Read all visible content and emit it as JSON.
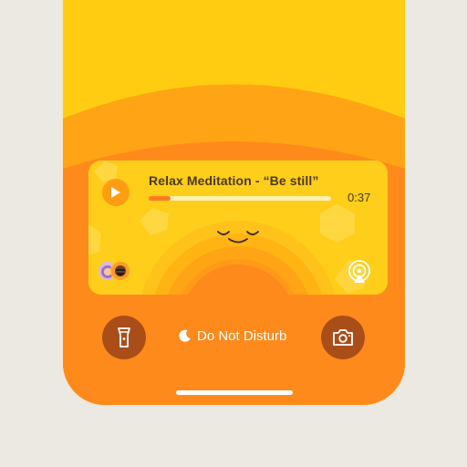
{
  "now_playing": {
    "title": "Relax Meditation - “Be still”",
    "elapsed": "0:37",
    "progress_fraction": 0.12,
    "play_icon": "play-icon",
    "airplay_icon": "airplay-icon",
    "avatars": [
      "avatar-woman-hijab",
      "avatar-man-beard"
    ]
  },
  "lock_screen": {
    "focus_mode_label": "Do Not Disturb",
    "focus_mode_icon": "moon-icon",
    "left_button_icon": "flashlight-icon",
    "right_button_icon": "camera-icon"
  },
  "colors": {
    "top_yellow": "#ffcc11",
    "mid_orange": "#ffa414",
    "bottom_orange": "#ff8a1c",
    "accent_orange": "#ff7a1f",
    "button_brown": "#a94e18"
  }
}
